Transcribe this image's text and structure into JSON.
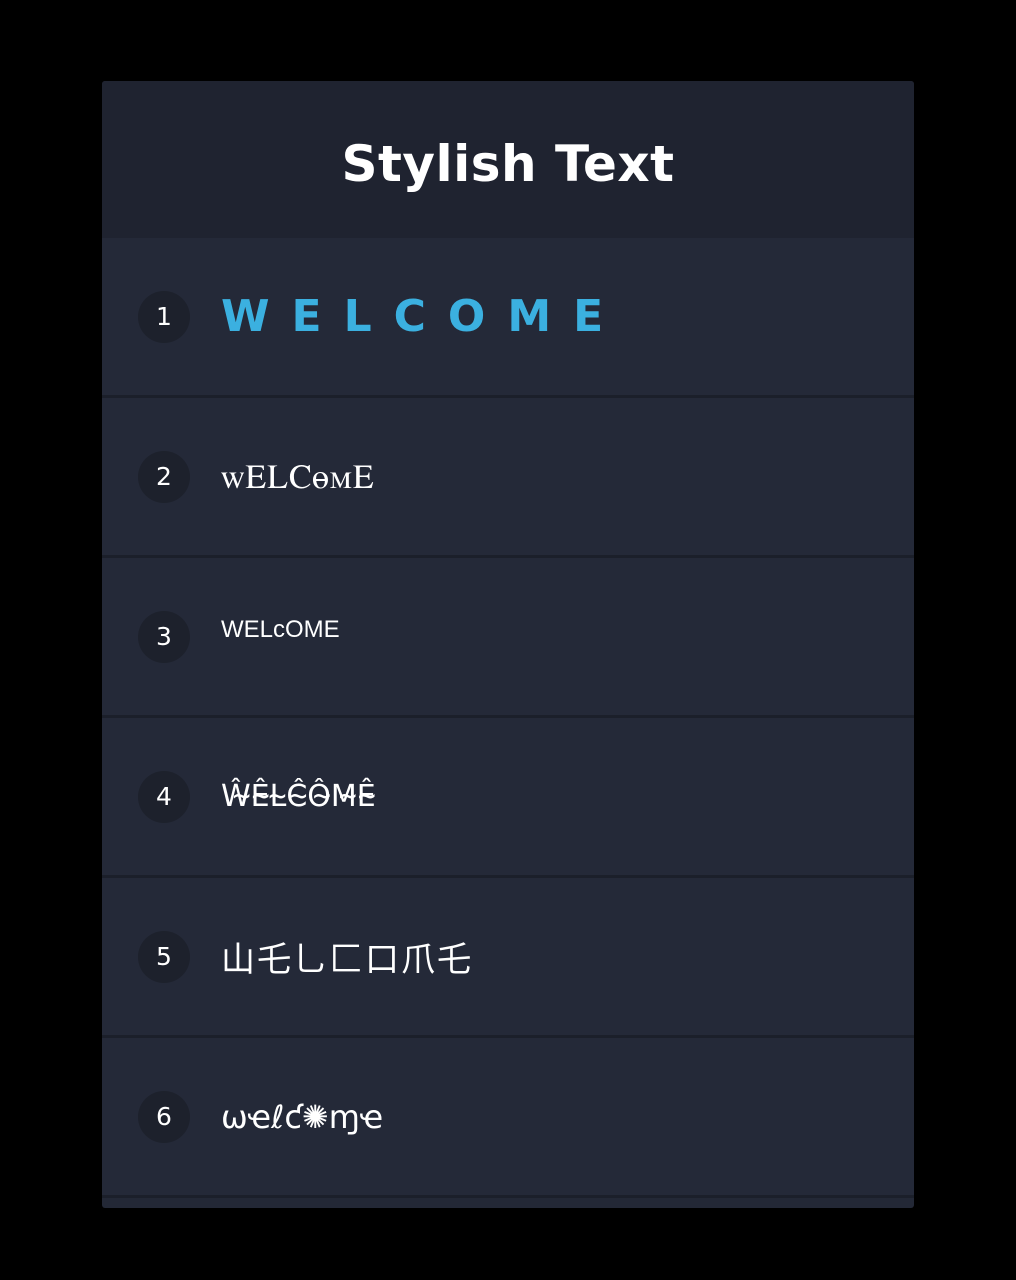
{
  "header": {
    "title": "Stylish Text"
  },
  "accent_color": "#3bb0e0",
  "items": [
    {
      "number": "1",
      "text": "WELCOME"
    },
    {
      "number": "2",
      "text": "ꮃᎬᏞᏟꮎꮇᎬ"
    },
    {
      "number": "3",
      "text": "WELcOME"
    },
    {
      "number": "4",
      "text": "Ŵ̴Ê̴L̴Ĉ̴Ô̴M̴Ê̴"
    },
    {
      "number": "5",
      "text": "山乇乚匚口爪乇"
    },
    {
      "number": "6",
      "text": "ωҽℓƈ✺ɱҽ"
    }
  ]
}
